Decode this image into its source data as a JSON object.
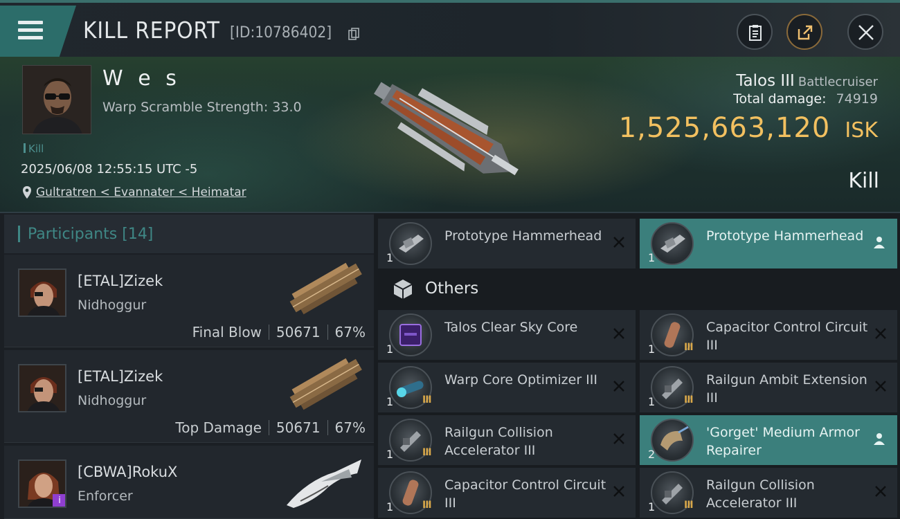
{
  "header": {
    "title": "KILL REPORT",
    "report_id": "[ID:10786402]"
  },
  "victim": {
    "name": "W e s",
    "subtitle": "Warp Scramble Strength: 33.0",
    "tag": "Kill",
    "datetime": "2025/06/08 12:55:15 UTC -5",
    "location": "Gultratren < Evannater < Heimatar",
    "ship_name": "Talos III",
    "ship_class": "Battlecruiser",
    "total_damage_label": "Total damage:",
    "total_damage": "74919",
    "isk_value": "1,525,663,120",
    "isk_unit": "ISK",
    "result": "Kill"
  },
  "participants": {
    "label": "Participants",
    "count": "[14]",
    "rows": [
      {
        "name": "[ETAL]Zizek",
        "ship": "Nidhoggur",
        "role": "Final Blow",
        "damage": "50671",
        "percent": "67%"
      },
      {
        "name": "[ETAL]Zizek",
        "ship": "Nidhoggur",
        "role": "Top Damage",
        "damage": "50671",
        "percent": "67%"
      },
      {
        "name": "[CBWA]RokuX",
        "ship": "Enforcer",
        "badge": "i"
      }
    ]
  },
  "items": {
    "top_row": [
      {
        "name": "Prototype Hammerhead",
        "qty": "1",
        "state": "destroyed"
      },
      {
        "name": "Prototype Hammerhead",
        "qty": "1",
        "state": "dropped"
      }
    ],
    "others_label": "Others",
    "others": [
      {
        "name": "Talos Clear Sky Core",
        "qty": "1",
        "tier": "",
        "state": "destroyed"
      },
      {
        "name": "Capacitor Control Circuit III",
        "qty": "1",
        "tier": "III",
        "state": "destroyed"
      },
      {
        "name": "Warp Core Optimizer III",
        "qty": "1",
        "tier": "III",
        "state": "destroyed"
      },
      {
        "name": "Railgun Ambit Extension III",
        "qty": "1",
        "tier": "III",
        "state": "destroyed"
      },
      {
        "name": "Railgun Collision Accelerator III",
        "qty": "1",
        "tier": "III",
        "state": "destroyed"
      },
      {
        "name": "'Gorget' Medium Armor Repairer",
        "qty": "2",
        "tier": "",
        "state": "dropped"
      },
      {
        "name": "Capacitor Control Circuit III",
        "qty": "1",
        "tier": "III",
        "state": "destroyed"
      },
      {
        "name": "Railgun Collision Accelerator III",
        "qty": "1",
        "tier": "III",
        "state": "destroyed"
      }
    ]
  },
  "colors": {
    "accent": "#3b7f7c",
    "isk": "#f2c060",
    "panel": "#242a30"
  }
}
